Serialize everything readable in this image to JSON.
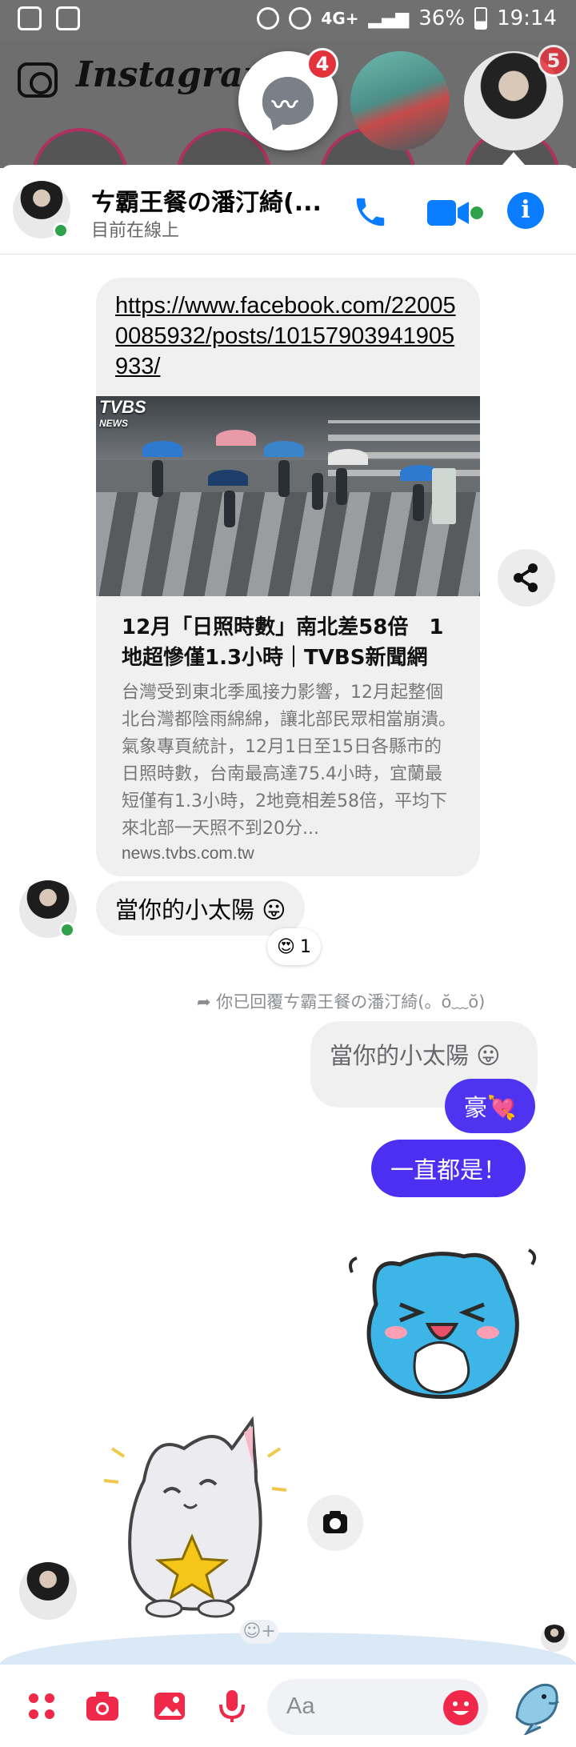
{
  "status_bar": {
    "battery": "36%",
    "time": "19:14",
    "network": "4G+"
  },
  "instagram": {
    "title": "Instagram"
  },
  "chat_heads": {
    "messenger_badge": "4",
    "third_badge": "5"
  },
  "header": {
    "name": "ㄘ霸王餐の潘汀綺(...",
    "status": "目前在線上"
  },
  "link_card": {
    "url": "https://www.facebook.com/220050085932/posts/10157903941905933/",
    "image_logo": "TVBS",
    "image_logo_sub": "NEWS",
    "title": "12月「日照時數」南北差58倍　1地超慘僅1.3小時｜TVBS新聞網",
    "description": "台灣受到東北季風接力影響，12月起整個北台灣都陰雨綿綿，讓北部民眾相當崩潰。氣象專頁統計，12月1日至15日各縣市的日照時數，台南最高達75.4小時，宜蘭最短僅有1.3小時，2地竟相差58倍，平均下來北部一天照不到20分...",
    "domain": "news.tvbs.com.tw"
  },
  "messages": {
    "incoming_1": "當你的小太陽 😛",
    "reaction_emoji": "😍",
    "reaction_count": "1",
    "reply_label": "你已回覆ㄘ霸王餐の潘汀綺(。ŏ﹏ŏ)",
    "quoted_text": "當你的小太陽 😛",
    "outgoing_1": "豪💘",
    "outgoing_2": "一直都是！"
  },
  "composer": {
    "placeholder": "Aa"
  },
  "colors": {
    "messenger_blue": "#0a7cff",
    "outgoing_bubble": "#4c2ff0",
    "composer_icon_red": "#f02849",
    "online_green": "#31a24c"
  }
}
